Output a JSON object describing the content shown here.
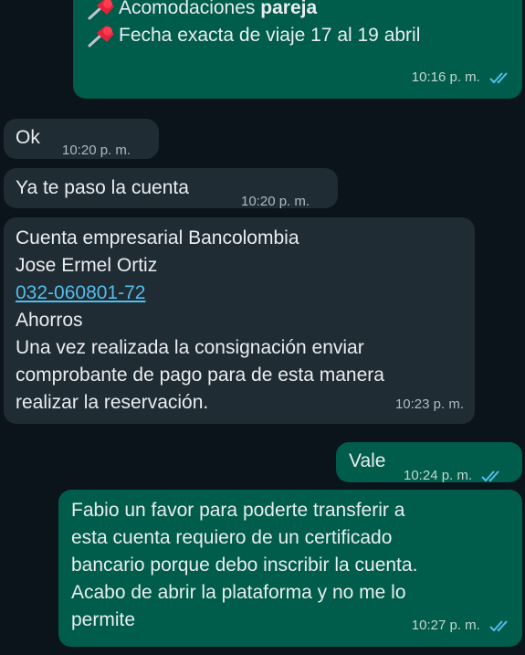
{
  "messages": {
    "m1": {
      "line1_prefix": "Acomodaciones ",
      "line1_bold": "pareja",
      "line2": "Fecha exacta de viaje 17 al 19 abril",
      "time": "10:16 p. m."
    },
    "m2": {
      "text": "Ok",
      "time": "10:20 p. m."
    },
    "m3": {
      "text": "Ya te paso la cuenta",
      "time": "10:20 p. m."
    },
    "m4": {
      "lines": [
        "Cuenta empresarial Bancolombia",
        "Jose Ermel Ortiz",
        "032-060801-72",
        "Ahorros",
        "Una vez realizada la consignación enviar",
        "comprobante de pago para de esta manera",
        "realizar la reservación."
      ],
      "time": "10:23 p. m."
    },
    "m5": {
      "text": "Vale",
      "time": "10:24 p. m."
    },
    "m6": {
      "lines": [
        "Fabio un favor para poderte transferir a",
        "esta cuenta requiero de un certificado",
        "bancario porque debo inscribir la cuenta.",
        "Acabo de abrir la plataforma y no me lo",
        "permite"
      ],
      "time": "10:27 p. m."
    }
  },
  "icons": {
    "pin": "pushpin-icon",
    "read": "double-check-icon"
  },
  "colors": {
    "background": "#0b141a",
    "outgoing": "#005c4b",
    "incoming": "#202c33",
    "read_check": "#53bdeb",
    "link": "#53bdeb"
  }
}
